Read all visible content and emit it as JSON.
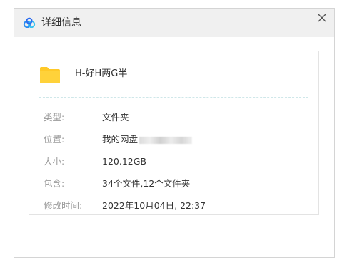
{
  "dialog": {
    "title": "详细信息",
    "icons": {
      "app": "baidu-cloud-icon",
      "close": "close-icon",
      "file": "folder-icon"
    },
    "colors": {
      "accent": "#2a8cf0",
      "folder": "#ffc928",
      "label": "#9a9a9a"
    }
  },
  "file": {
    "name": "H-好H两G半"
  },
  "details": [
    {
      "label": "类型:",
      "value": "文件夹"
    },
    {
      "label": "位置:",
      "value": "我的网盘"
    },
    {
      "label": "大小:",
      "value": "120.12GB"
    },
    {
      "label": "包含:",
      "value": "34个文件,12个文件夹"
    },
    {
      "label": "修改时间:",
      "value": "2022年10月04日, 22:37"
    }
  ]
}
